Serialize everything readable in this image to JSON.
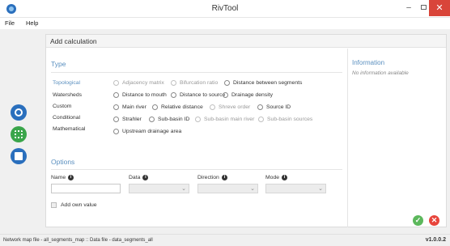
{
  "window": {
    "title": "RivTool",
    "minimize": "–",
    "close": "✕"
  },
  "menu": [
    {
      "label": "File"
    },
    {
      "label": "Help"
    }
  ],
  "sidebar": {
    "icons": [
      "globe-icon",
      "grid-icon",
      "edit-icon"
    ]
  },
  "panel": {
    "header": "Add calculation"
  },
  "type_section": {
    "title": "Type",
    "categories": [
      "Topological",
      "Watersheds",
      "Custom",
      "Conditional",
      "Mathematical"
    ],
    "active_category": "Topological",
    "options": [
      {
        "label": "Adjacency matrix",
        "enabled": false
      },
      {
        "label": "Bifurcation ratio",
        "enabled": false
      },
      {
        "label": "Distance between segments",
        "enabled": true
      },
      {
        "label": "Distance to mouth",
        "enabled": true
      },
      {
        "label": "Distance to source",
        "enabled": true
      },
      {
        "label": "Drainage density",
        "enabled": true
      },
      {
        "label": "Main river",
        "enabled": true
      },
      {
        "label": "Relative distance",
        "enabled": true
      },
      {
        "label": "Shreve order",
        "enabled": false
      },
      {
        "label": "Source ID",
        "enabled": true
      },
      {
        "label": "Strahler",
        "enabled": true
      },
      {
        "label": "Sub-basin ID",
        "enabled": true
      },
      {
        "label": "Sub-basin main river",
        "enabled": false
      },
      {
        "label": "Sub-basin sources",
        "enabled": false
      },
      {
        "label": "Upstream drainage area",
        "enabled": true
      }
    ]
  },
  "information": {
    "title": "Information",
    "text": "No information available"
  },
  "options_section": {
    "title": "Options",
    "fields": [
      {
        "label": "Name",
        "value": ""
      },
      {
        "label": "Data",
        "value": ""
      },
      {
        "label": "Direction",
        "value": ""
      },
      {
        "label": "Mode",
        "value": ""
      }
    ],
    "add_own_value": "Add own value",
    "info_badge": "i",
    "chevron": "⌄"
  },
  "actions": {
    "ok": "✓",
    "cancel": "✕"
  },
  "status": {
    "text": "Network map file - all_segments_map  ::  Data file - data_segments_all",
    "version": "v1.0.0.2"
  },
  "colors": {
    "accent": "#5a8fbf",
    "ok": "#5cb85c",
    "cancel": "#e8453c",
    "close": "#d9453a"
  }
}
